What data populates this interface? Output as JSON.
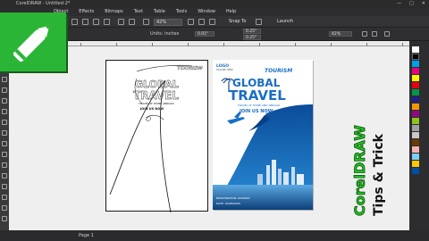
{
  "window": {
    "title": "CorelDRAW - Untitled-2*",
    "controls": [
      "—",
      "□",
      "✕"
    ]
  },
  "menubar": {
    "items": [
      "Object",
      "Effects",
      "Bitmaps",
      "Text",
      "Table",
      "Tools",
      "Window",
      "Help"
    ]
  },
  "toolbar": {
    "zoom": "42%",
    "snap_to": "Snap To",
    "launch": "Launch"
  },
  "propbar": {
    "units": "Units: inches",
    "nudge": "0.01\"",
    "dup_x": "0.25\"",
    "dup_y": "0.25\"",
    "zoom": "42%"
  },
  "poster_outline": {
    "tourism": "TOURISM",
    "global": "GLOBAL",
    "travel": "TRAVEL",
    "tagline": "TRAVEL AT HOME ABROAD",
    "join": "JOIN US NOW"
  },
  "poster": {
    "logo": "LOGO",
    "logo_sub": "TAGLINE HERE",
    "tourism": "TOURISM",
    "global": "GLOBAL",
    "travel": "TRAVEL",
    "tagline": "TRAVEL AT HOME AND ABROAD",
    "join": "JOIN US NOW",
    "footer1": "REGISTRATION: 0000000",
    "footer2": "DATE: 00/00/0000"
  },
  "overlay": {
    "line1": "CorelDRAW",
    "line2": "Tips & Trick"
  },
  "status": {
    "page_label": "Page 1"
  },
  "colors": {
    "brand_green": "#2bb536",
    "overlay_green": "#1fc41f",
    "poster_blue": "#1a6fc4"
  }
}
